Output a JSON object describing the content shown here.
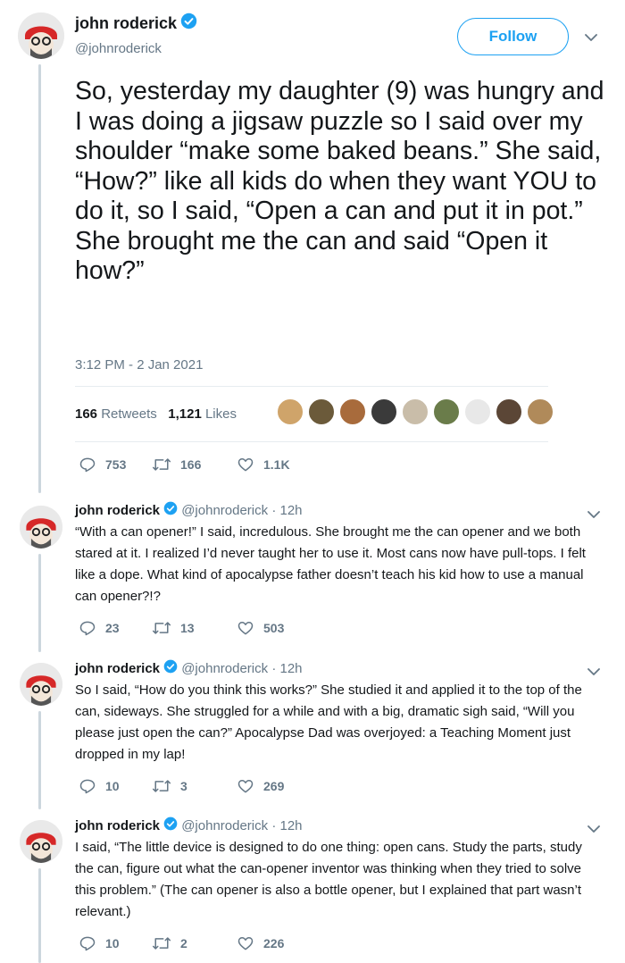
{
  "main": {
    "display_name": "john roderick",
    "handle": "@johnroderick",
    "follow_label": "Follow",
    "text": "So, yesterday my daughter (9) was hungry and I was doing a jigsaw puzzle so I said over my shoulder “make some baked beans.” She said, “How?” like all kids do when they want YOU to do it, so I said, “Open a can and put it in pot.” She brought me the can and said “Open it how?”",
    "timestamp": "3:12 PM - 2 Jan 2021",
    "retweets_count": "166",
    "retweets_label": "Retweets",
    "likes_count": "1,121",
    "likes_label": "Likes",
    "actions": {
      "replies": "753",
      "retweets": "166",
      "likes": "1.1K"
    }
  },
  "replies": [
    {
      "display_name": "john roderick",
      "handle": "@johnroderick",
      "time": "· 12h",
      "text": "“With a can opener!” I said, incredulous. She brought me the can opener and we both stared at it. I realized I’d never taught her to use it. Most cans now have pull-tops. I felt like a dope. What kind of apocalypse father doesn’t teach his kid how to use a manual can opener?!?",
      "actions": {
        "replies": "23",
        "retweets": "13",
        "likes": "503"
      }
    },
    {
      "display_name": "john roderick",
      "handle": "@johnroderick",
      "time": "· 12h",
      "text": "So I said, “How do you think this works?” She studied it and applied it to the top of the can, sideways. She struggled for a while and with a big, dramatic sigh said, “Will you please just open the can?” Apocalypse Dad was overjoyed: a Teaching Moment just dropped in my lap!",
      "actions": {
        "replies": "10",
        "retweets": "3",
        "likes": "269"
      }
    },
    {
      "display_name": "john roderick",
      "handle": "@johnroderick",
      "time": "· 12h",
      "text": "I said, “The little device is designed to do one thing: open cans. Study the parts, study the can, figure out what the can-opener inventor was thinking when they tried to solve this problem.” (The can opener is also a bottle opener, but I explained that part wasn’t relevant.)",
      "actions": {
        "replies": "10",
        "retweets": "2",
        "likes": "226"
      }
    }
  ],
  "icons": {
    "avatar": "avatar-icon",
    "verified": "verified-badge-icon",
    "chevron": "chevron-down-icon",
    "reply": "reply-icon",
    "retweet": "retweet-icon",
    "like": "heart-icon"
  },
  "colors": {
    "accent": "#1da1f2",
    "muted": "#657786",
    "text": "#14171a",
    "divider": "#e6ecf0",
    "thread": "#ccd6dd"
  }
}
